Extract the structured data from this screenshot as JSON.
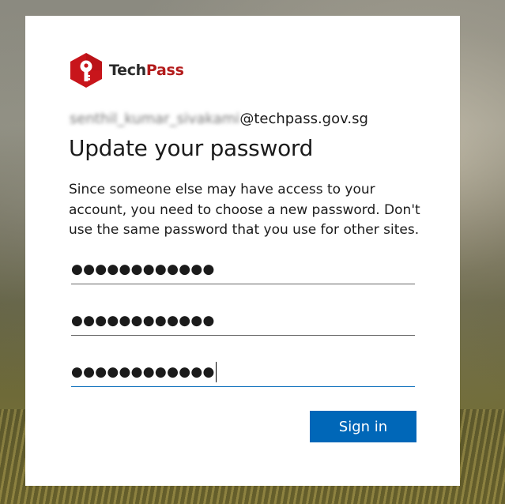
{
  "brand": {
    "name_part1": "Tech",
    "name_part2": "Pass",
    "logo_icon": "key-hexagon-icon",
    "colors": {
      "brand_red": "#b31b1b",
      "dark_text": "#2b2b2b"
    }
  },
  "identity": {
    "username_blurred": "senthil_kumar_sivakami",
    "domain": "@techpass.gov.sg"
  },
  "title": "Update your password",
  "description": "Since someone else may have access to your account, you need to choose a new password. Don't use the same password that you use for other sites.",
  "fields": [
    {
      "value": "●●●●●●●●●●●●",
      "state": "filled"
    },
    {
      "value": "●●●●●●●●●●●●",
      "state": "filled"
    },
    {
      "value": "●●●●●●●●●●●●",
      "state": "focused"
    }
  ],
  "sign_in_label": "Sign in",
  "colors": {
    "accent": "#0067b8",
    "input_border": "#666666"
  }
}
